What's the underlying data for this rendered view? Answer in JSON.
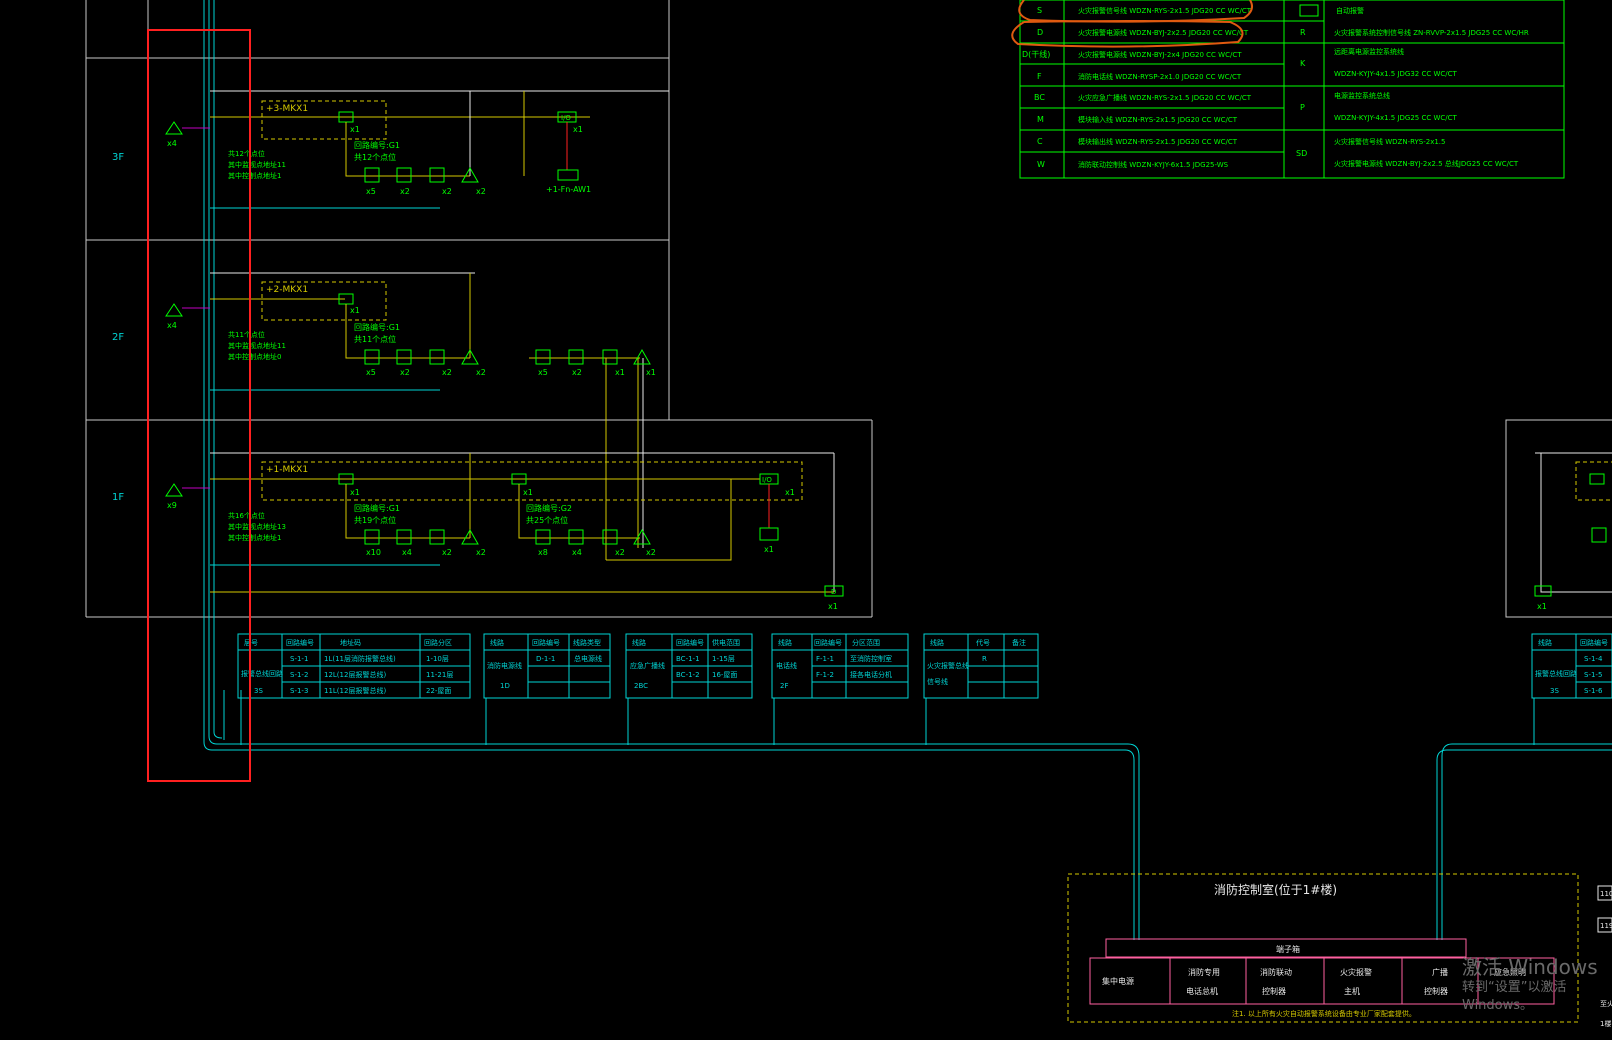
{
  "floors": [
    "3F",
    "2F",
    "1F"
  ],
  "devices": {
    "f3": {
      "counts": [
        "x5",
        "x2",
        "x2",
        "x2"
      ],
      "iso": "x1",
      "module": "+3-MKX1",
      "io": "I/O",
      "io_x": "x1",
      "fas": "+1-Fn-AW1",
      "sb_count": "x4",
      "labels": [
        "回路编号:G1",
        "共12个点位"
      ],
      "notes": [
        "共12个点位",
        "其中监视点地址11",
        "其中控制点地址1"
      ]
    },
    "f2": {
      "counts": [
        "x5",
        "x2",
        "x2",
        "x2"
      ],
      "iso": "x1",
      "module": "+2-MKX1",
      "sb_count": "x4",
      "labels": [
        "回路编号:G1",
        "共11个点位"
      ],
      "notes": [
        "共11个点位",
        "其中监视点地址11",
        "其中控制点地址0"
      ],
      "ext_counts": [
        "x5",
        "x2",
        "x1",
        "x1"
      ]
    },
    "f1": {
      "counts1": [
        "x10",
        "x4",
        "x2",
        "x2"
      ],
      "counts2": [
        "x8",
        "x4",
        "x2",
        "x2"
      ],
      "iso": "x1",
      "module": "+1-MKX1",
      "io": "I/O",
      "io_x": "x1",
      "iodev_x": "x1",
      "sb_count": "x9",
      "labels1": [
        "回路编号:G1",
        "共19个点位"
      ],
      "labels2": [
        "回路编号:G2",
        "共25个点位"
      ],
      "notes": [
        "共16个点位",
        "其中监视点地址13",
        "其中控制点地址1"
      ],
      "d_x": "x1"
    }
  },
  "legend": {
    "left_codes": [
      "S",
      "D",
      "D(干线)",
      "F",
      "BC",
      "M",
      "C",
      "W"
    ],
    "left_texts": [
      "火灾报警信号线 WDZN-RYS-2x1.5 JDG20 CC WC/CT",
      "火灾报警电源线 WDZN-BYJ-2x2.5 JDG20 CC WC/CT",
      "火灾报警电源线 WDZN-BYJ-2x4 JDG20 CC WC/CT",
      "消防电话线 WDZN-RYSP-2x1.0 JDG20 CC WC/CT",
      "火灾应急广播线 WDZN-RYS-2x1.5 JDG20 CC WC/CT",
      "模块输入线 WDZN-RYS-2x1.5 JDG20 CC WC/CT",
      "模块输出线 WDZN-RYS-2x1.5 JDG20 CC WC/CT",
      "消防联动控制线 WDZN-KYJY-6x1.5 JDG25-WS"
    ],
    "right_codes": [
      "R",
      "K",
      "P",
      "SD"
    ],
    "right_texts": [
      "自动报警 ",
      "火灾报警系统控制信号线 ZN-RVVP-2x1.5 JDG25 CC WC/HR",
      "远距离电源监控系统线",
      "WDZN-KYJY-4x1.5 JDG32 CC WC/CT",
      "电源监控系统总线",
      "WDZN-KYJY-4x1.5 JDG25 CC WC/CT",
      "火灾报警信号线 WDZN-RYS-2x1.5",
      "火灾报警电源线 WDZN-BYJ-2x2.5 总线JDG25 CC WC/CT"
    ],
    "first_right": "自动报警"
  },
  "tables": [
    {
      "h": [
        "层号",
        "回路编号",
        "地址码",
        "回路分区"
      ],
      "sys": "报警总线回路",
      "floor": "3S",
      "rows": [
        [
          "S-1-1",
          "1L(11层消防报警总线)",
          "1-10层"
        ],
        [
          "S-1-2",
          "12L(12层报警总线)",
          "11-21层"
        ],
        [
          "S-1-3",
          "11L(12层报警总线)",
          "22-屋面"
        ]
      ]
    },
    {
      "h": [
        "线路",
        "回路编号",
        "线路类型"
      ],
      "sys": "消防电源线",
      "floor": "1D",
      "rows": [
        [
          "D-1-1",
          "总电源线"
        ]
      ]
    },
    {
      "h": [
        "线路",
        "回路编号",
        "供电范围"
      ],
      "sys": "应急广播线",
      "floor": "2BC",
      "rows": [
        [
          "BC-1-1",
          "1-15层"
        ],
        [
          "BC-1-2",
          "16-屋面"
        ]
      ]
    },
    {
      "h": [
        "线路",
        "回路编号",
        "分区范围"
      ],
      "sys": "电话线",
      "floor": "2F",
      "rows": [
        [
          "F-1-1",
          "至消防控制室"
        ],
        [
          "F-1-2",
          "接各电话分机"
        ]
      ]
    },
    {
      "h": [
        "线路",
        "代号",
        "备注"
      ],
      "sys": "火灾报警总线",
      "floor": "信号线",
      "rows": [
        [
          "R",
          ""
        ]
      ]
    }
  ],
  "right_table": {
    "h": [
      "线路",
      "回路编号"
    ],
    "sys": "报警总线回路",
    "floor": "3S",
    "rows": [
      [
        "S-1-4"
      ],
      [
        "S-1-5"
      ],
      [
        "S-1-6"
      ]
    ]
  },
  "control_room": {
    "title": "消防控制室(位于1#楼)",
    "bar": "端子箱",
    "cells": [
      [
        "集中电源"
      ],
      [
        "消防专用",
        "电话总机"
      ],
      [
        "消防联动",
        "控制器"
      ],
      [
        "火灾报警",
        "主机"
      ],
      [
        "广播",
        "控制器"
      ],
      [
        "应急照明",
        ""
      ]
    ],
    "note": "注1. 以上所有火灾自动报警系统设备由专业厂家配套提供。"
  },
  "edge_labels": [
    "110",
    "119",
    "至火",
    "1楼"
  ],
  "d_label": "D",
  "x1_label": "x1",
  "watermark": {
    "line1": "激活 Windows",
    "line2": "转到“设置”以激活 Windows。"
  },
  "colors": {
    "green": "#00ff00",
    "cyan": "#00d4d4",
    "yellow": "#d4c800",
    "white": "#e8e8e8",
    "red": "#ff2020",
    "orange": "#e05a10",
    "magenta": "#c000c0",
    "orange_wire": "#d88a00",
    "pink": "#ff60a0"
  }
}
